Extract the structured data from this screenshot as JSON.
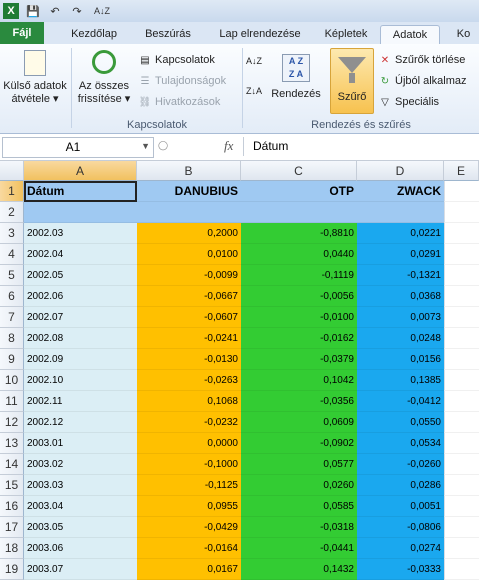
{
  "quick_access": {
    "excel_icon": "X",
    "save_icon": "💾",
    "undo_icon": "↶",
    "redo_icon": "↷",
    "sort_icon": "A↓Z"
  },
  "tabs": [
    "Fájl",
    "Kezdőlap",
    "Beszúrás",
    "Lap elrendezése",
    "Képletek",
    "Adatok",
    "Ko"
  ],
  "active_tab": "Adatok",
  "ribbon": {
    "external_data_label": "Külső adatok",
    "external_data_label2": "átvétele ▾",
    "refresh_all_label": "Az összes",
    "refresh_all_label2": "frissítése ▾",
    "connections": "Kapcsolatok",
    "properties": "Tulajdonságok",
    "edit_links": "Hivatkozások",
    "group_connections": "Kapcsolatok",
    "sort_asc_icon": "A↓Z",
    "sort_desc_icon": "Z↓A",
    "sort_label": "Rendezés",
    "filter_label": "Szűrő",
    "clear": "Szűrők törlése",
    "reapply": "Újból alkalmaz",
    "advanced": "Speciális",
    "group_sort_filter": "Rendezés és szűrés"
  },
  "formula_bar": {
    "name_box": "A1",
    "fx": "fx",
    "formula": "Dátum"
  },
  "columns": [
    "A",
    "B",
    "C",
    "D",
    "E"
  ],
  "header_row": {
    "a": "Dátum",
    "b": "DANUBIUS",
    "c": "OTP",
    "d": "ZWACK"
  },
  "rows": [
    {
      "n": "3",
      "a": "2002.03",
      "b": "0,2000",
      "c": "-0,8810",
      "d": "0,0221"
    },
    {
      "n": "4",
      "a": "2002.04",
      "b": "0,0100",
      "c": "0,0440",
      "d": "0,0291"
    },
    {
      "n": "5",
      "a": "2002.05",
      "b": "-0,0099",
      "c": "-0,1119",
      "d": "-0,1321"
    },
    {
      "n": "6",
      "a": "2002.06",
      "b": "-0,0667",
      "c": "-0,0056",
      "d": "0,0368"
    },
    {
      "n": "7",
      "a": "2002.07",
      "b": "-0,0607",
      "c": "-0,0100",
      "d": "0,0073"
    },
    {
      "n": "8",
      "a": "2002.08",
      "b": "-0,0241",
      "c": "-0,0162",
      "d": "0,0248"
    },
    {
      "n": "9",
      "a": "2002.09",
      "b": "-0,0130",
      "c": "-0,0379",
      "d": "0,0156"
    },
    {
      "n": "10",
      "a": "2002.10",
      "b": "-0,0263",
      "c": "0,1042",
      "d": "0,1385"
    },
    {
      "n": "11",
      "a": "2002.11",
      "b": "0,1068",
      "c": "-0,0356",
      "d": "-0,0412"
    },
    {
      "n": "12",
      "a": "2002.12",
      "b": "-0,0232",
      "c": "0,0609",
      "d": "0,0550"
    },
    {
      "n": "13",
      "a": "2003.01",
      "b": "0,0000",
      "c": "-0,0902",
      "d": "0,0534"
    },
    {
      "n": "14",
      "a": "2003.02",
      "b": "-0,1000",
      "c": "0,0577",
      "d": "-0,0260"
    },
    {
      "n": "15",
      "a": "2003.03",
      "b": "-0,1125",
      "c": "0,0260",
      "d": "0,0286"
    },
    {
      "n": "16",
      "a": "2003.04",
      "b": "0,0955",
      "c": "0,0585",
      "d": "0,0051"
    },
    {
      "n": "17",
      "a": "2003.05",
      "b": "-0,0429",
      "c": "-0,0318",
      "d": "-0,0806"
    },
    {
      "n": "18",
      "a": "2003.06",
      "b": "-0,0164",
      "c": "-0,0441",
      "d": "0,0274"
    },
    {
      "n": "19",
      "a": "2003.07",
      "b": "0,0167",
      "c": "0,1432",
      "d": "-0,0333"
    }
  ],
  "colors": {
    "col_a": "#dbeef5",
    "col_b": "#ffc000",
    "col_c": "#33cc33",
    "col_d": "#1aa8ef",
    "header_row": "#9fc9f2",
    "file_tab": "#2a8a3e"
  }
}
